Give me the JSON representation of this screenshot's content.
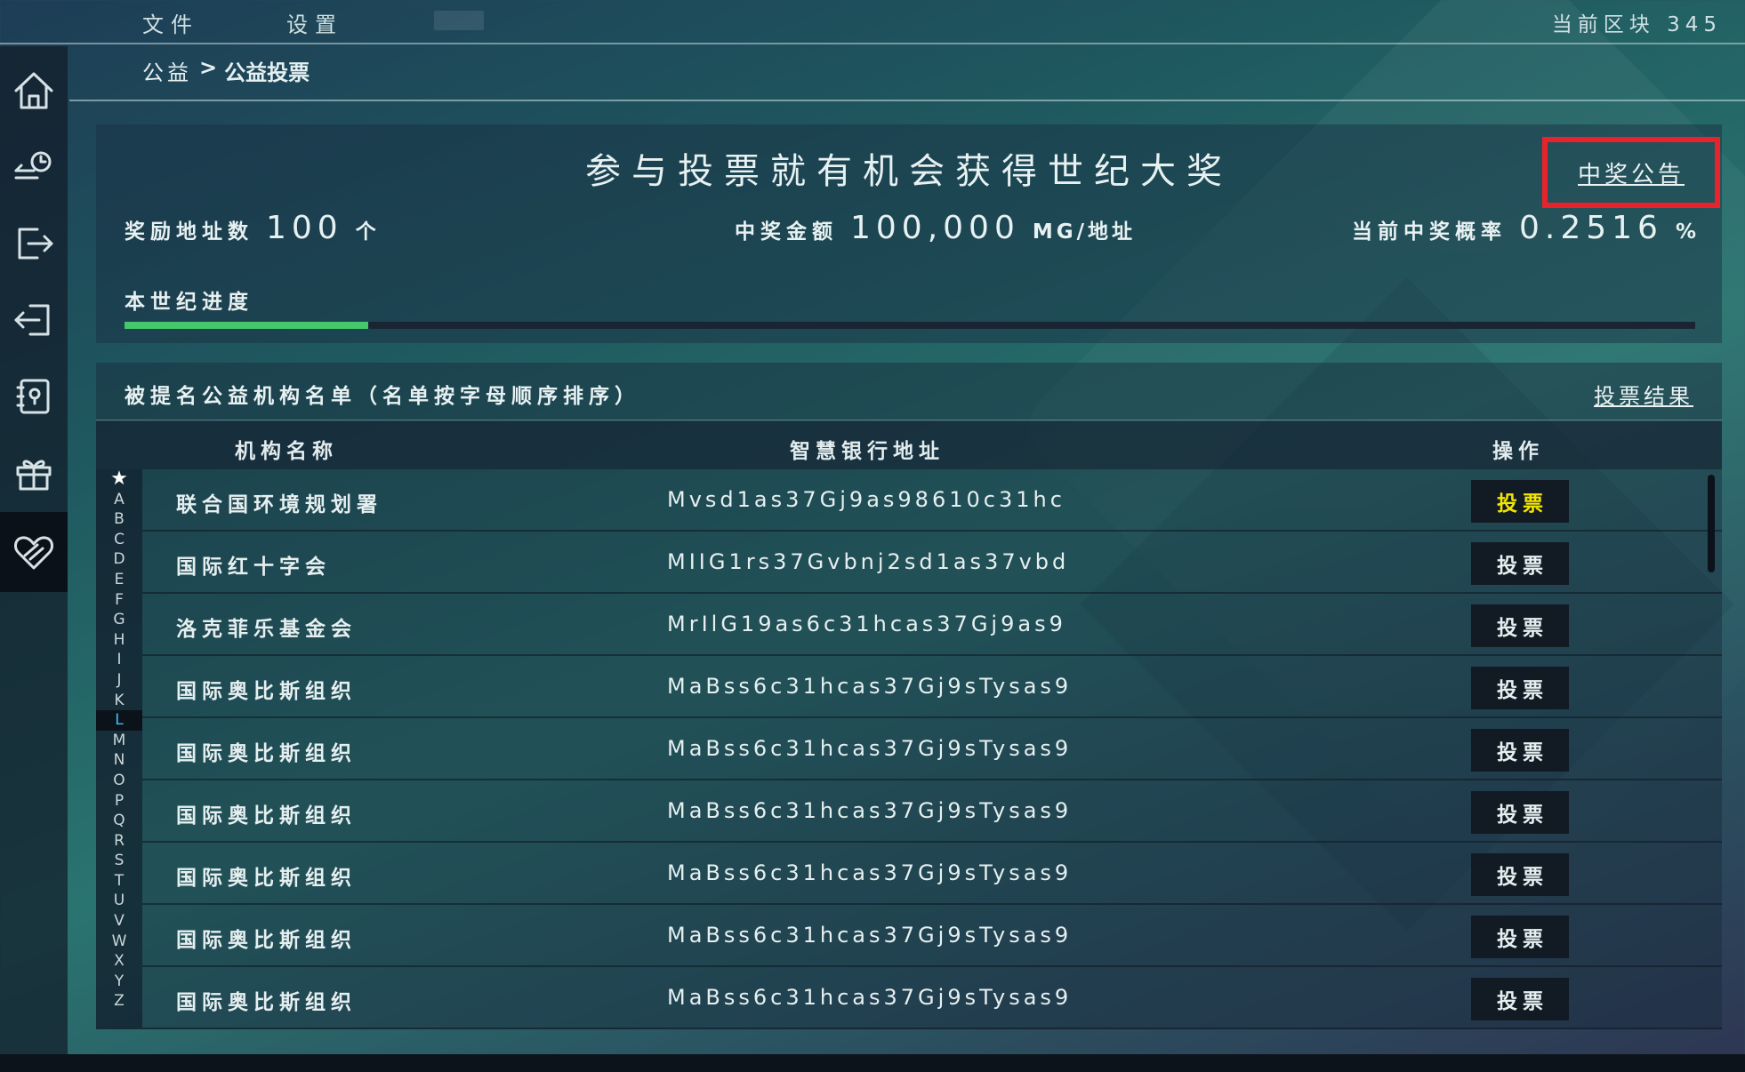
{
  "menu": {
    "file": "文件",
    "settings": "设置"
  },
  "block_info": "当前区块 345",
  "breadcrumb": {
    "root": "公益",
    "sep": ">",
    "current": "公益投票"
  },
  "sidebar": {
    "items": [
      {
        "icon": "home-icon"
      },
      {
        "icon": "transfer-history-icon"
      },
      {
        "icon": "send-out-icon"
      },
      {
        "icon": "receive-in-icon"
      },
      {
        "icon": "address-book-icon"
      },
      {
        "icon": "gift-icon"
      },
      {
        "icon": "charity-heart-icon",
        "active": true
      }
    ]
  },
  "info": {
    "slogan": "参与投票就有机会获得世纪大奖",
    "announcement_link": "中奖公告",
    "reward_count_label": "奖励地址数",
    "reward_count_value": "100",
    "reward_count_unit": "个",
    "prize_label": "中奖金额",
    "prize_value": "100,000",
    "prize_unit": "MG/地址",
    "rate_label": "当前中奖概率",
    "rate_value": "0.2516",
    "rate_unit": "%",
    "progress_label": "本世纪进度",
    "progress_fraction": 0.155,
    "accent_color": "#45c86b",
    "highlight_box_color": "#e8232c"
  },
  "list": {
    "title": "被提名公益机构名单（名单按字母顺序排序）",
    "results_link": "投票结果",
    "headers": {
      "name": "机构名称",
      "address": "智慧银行地址",
      "action": "操作"
    },
    "alphabet": [
      "★",
      "A",
      "B",
      "C",
      "D",
      "E",
      "F",
      "G",
      "H",
      "I",
      "J",
      "K",
      "L",
      "M",
      "N",
      "O",
      "P",
      "Q",
      "R",
      "S",
      "T",
      "U",
      "V",
      "W",
      "X",
      "Y",
      "Z"
    ],
    "alphabet_active": "L",
    "rows": [
      {
        "name": "联合国环境规划署",
        "address": "Mvsd1as37Gj9as98610c31hc",
        "action": "投票",
        "highlight": true
      },
      {
        "name": "国际红十字会",
        "address": "MIIG1rs37Gvbnj2sd1as37vbd",
        "action": "投票"
      },
      {
        "name": "洛克菲乐基金会",
        "address": "MrIlG19as6c31hcas37Gj9as9",
        "action": "投票"
      },
      {
        "name": "国际奥比斯组织",
        "address": "MaBss6c31hcas37Gj9sTysas9",
        "action": "投票"
      },
      {
        "name": "国际奥比斯组织",
        "address": "MaBss6c31hcas37Gj9sTysas9",
        "action": "投票"
      },
      {
        "name": "国际奥比斯组织",
        "address": "MaBss6c31hcas37Gj9sTysas9",
        "action": "投票"
      },
      {
        "name": "国际奥比斯组织",
        "address": "MaBss6c31hcas37Gj9sTysas9",
        "action": "投票"
      },
      {
        "name": "国际奥比斯组织",
        "address": "MaBss6c31hcas37Gj9sTysas9",
        "action": "投票"
      },
      {
        "name": "国际奥比斯组织",
        "address": "MaBss6c31hcas37Gj9sTysas9",
        "action": "投票"
      }
    ]
  }
}
